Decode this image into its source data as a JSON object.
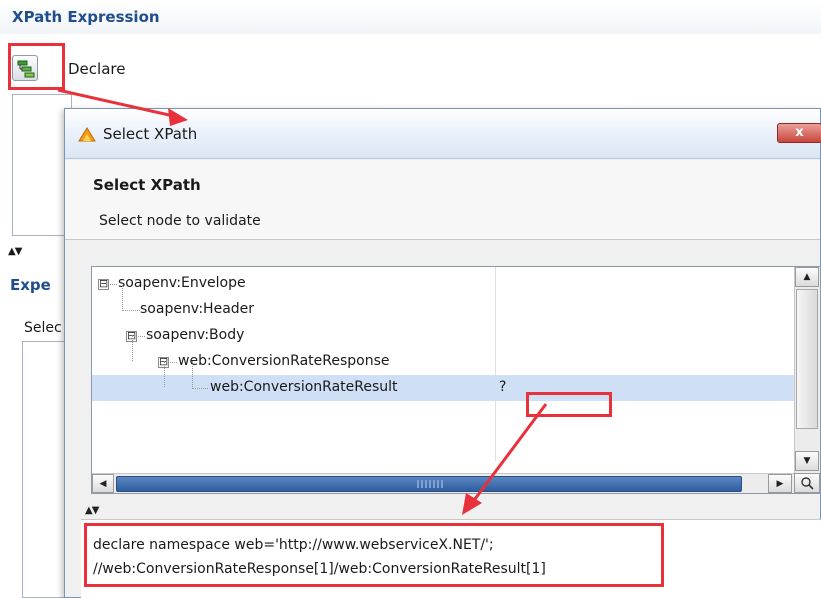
{
  "background_panel": {
    "section_title": "XPath Expression",
    "declare_label": "Declare",
    "expression_title_partial": "Expe",
    "select_partial": "Selec",
    "splitter_arrows": "▲▼"
  },
  "dialog": {
    "title": "Select XPath",
    "close_label": "x",
    "header_title": "Select XPath",
    "header_subtitle": "Select node to validate",
    "tree": {
      "nodes": [
        {
          "label": "soapenv:Envelope",
          "expander": "⊟",
          "value": ""
        },
        {
          "label": "soapenv:Header",
          "expander": "",
          "value": ""
        },
        {
          "label": "soapenv:Body",
          "expander": "⊟",
          "value": ""
        },
        {
          "label": "web:ConversionRateResponse",
          "expander": "⊟",
          "value": ""
        },
        {
          "label": "web:ConversionRateResult",
          "expander": "",
          "value": "?",
          "selected": true
        }
      ]
    },
    "scroll": {
      "up": "▲",
      "down": "▼",
      "left": "◀",
      "right": "▶"
    },
    "splitter_arrows": "▲▼",
    "result": {
      "line1": "declare namespace web='http://www.webserviceX.NET/';",
      "line2": "//web:ConversionRateResponse[1]/web:ConversionRateResult[1]"
    }
  },
  "colors": {
    "highlight_red": "#e8313a",
    "selection_blue": "#cfe0f6",
    "title_blue": "#1f4e8c"
  },
  "icons": [
    "declare-tree-icon",
    "app-flame-icon",
    "close-icon",
    "zoom-icon"
  ]
}
